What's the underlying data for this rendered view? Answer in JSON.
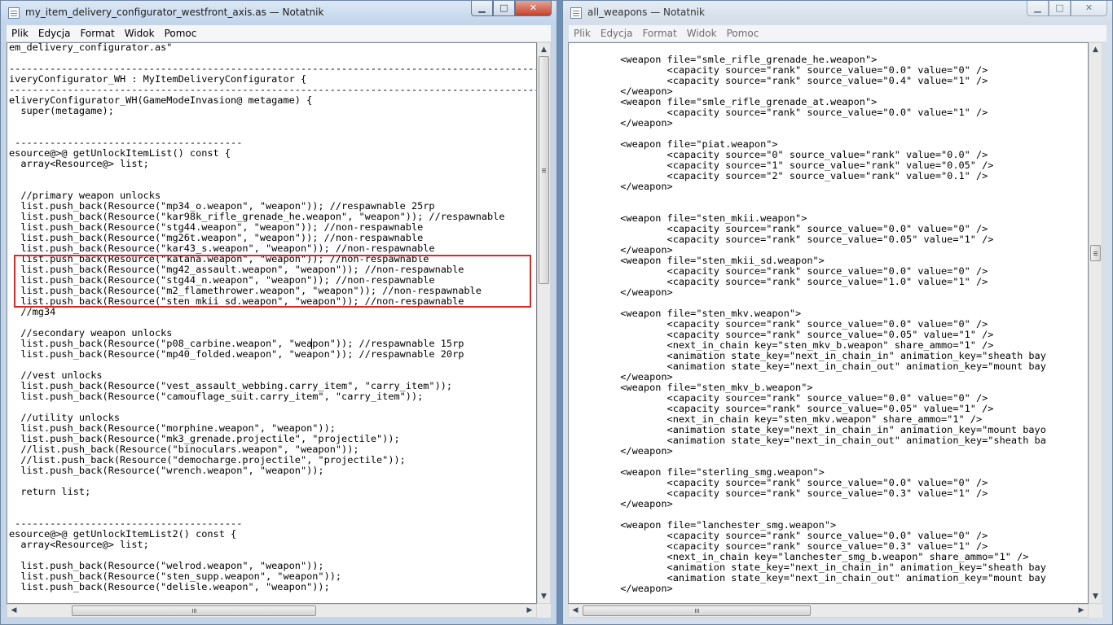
{
  "left_window": {
    "title": "my_item_delivery_configurator_westfront_axis.as — Notatnik",
    "menu": [
      "Plik",
      "Edycja",
      "Format",
      "Widok",
      "Pomoc"
    ],
    "code_lines": [
      "em_delivery_configurator.as\"",
      "",
      "--------------------------------------------------------------------------------------------------",
      "iveryConfigurator_WH : MyItemDeliveryConfigurator {",
      "--------------------------------------------------------------------------------------------------",
      "eliveryConfigurator_WH(GameModeInvasion@ metagame) {",
      "  super(metagame);",
      "",
      "",
      " ---------------------------------------",
      "esource@>@ getUnlockItemList() const {",
      "  array<Resource@> list;",
      "",
      "",
      "  //primary weapon unlocks",
      "  list.push_back(Resource(\"mp34_o.weapon\", \"weapon\")); //respawnable 25rp",
      "  list.push_back(Resource(\"kar98k_rifle_grenade_he.weapon\", \"weapon\")); //respawnable",
      "  list.push_back(Resource(\"stg44.weapon\", \"weapon\")); //non-respawnable",
      "  list.push_back(Resource(\"mg26t.weapon\", \"weapon\")); //non-respawnable",
      "  list.push_back(Resource(\"kar43_s.weapon\", \"weapon\")); //non-respawnable",
      "  list.push_back(Resource(\"katana.weapon\", \"weapon\")); //non-respawnable",
      "  list.push_back(Resource(\"mg42_assault.weapon\", \"weapon\")); //non-respawnable",
      "  list.push_back(Resource(\"stg44_n.weapon\", \"weapon\")); //non-respawnable",
      "  list.push_back(Resource(\"m2_flamethrower.weapon\", \"weapon\")); //non-respawnable",
      "  list.push_back(Resource(\"sten_mkii_sd.weapon\", \"weapon\")); //non-respawnable",
      "  //mg34",
      "",
      "  //secondary weapon unlocks",
      "  list.push_back(Resource(\"p08_carbine.weapon\", \"weapon\")); //respawnable 15rp",
      "  list.push_back(Resource(\"mp40_folded.weapon\", \"weapon\")); //respawnable 20rp",
      "",
      "  //vest unlocks",
      "  list.push_back(Resource(\"vest_assault_webbing.carry_item\", \"carry_item\"));",
      "  list.push_back(Resource(\"camouflage_suit.carry_item\", \"carry_item\"));",
      "",
      "  //utility unlocks",
      "  list.push_back(Resource(\"morphine.weapon\", \"weapon\"));",
      "  list.push_back(Resource(\"mk3_grenade.projectile\", \"projectile\"));",
      "  //list.push_back(Resource(\"binoculars.weapon\", \"weapon\"));",
      "  //list.push_back(Resource(\"democharge.projectile\", \"projectile\"));",
      "  list.push_back(Resource(\"wrench.weapon\", \"weapon\"));",
      "",
      "  return list;",
      "",
      "",
      " ---------------------------------------",
      "esource@>@ getUnlockItemList2() const {",
      "  array<Resource@> list;",
      "",
      "  list.push_back(Resource(\"welrod.weapon\", \"weapon\"));",
      "  list.push_back(Resource(\"sten_supp.weapon\", \"weapon\"));",
      "  list.push_back(Resource(\"delisle.weapon\", \"weapon\"));"
    ]
  },
  "right_window": {
    "title": "all_weapons — Notatnik",
    "menu": [
      "Plik",
      "Edycja",
      "Format",
      "Widok",
      "Pomoc"
    ],
    "code_lines": [
      "        <weapon file=\"smle_rifle_grenade_he.weapon\">",
      "                <capacity source=\"rank\" source_value=\"0.0\" value=\"0\" />",
      "                <capacity source=\"rank\" source_value=\"0.4\" value=\"1\" />",
      "        </weapon>",
      "        <weapon file=\"smle_rifle_grenade_at.weapon\">",
      "                <capacity source=\"rank\" source_value=\"0.0\" value=\"1\" />",
      "        </weapon>",
      "",
      "        <weapon file=\"piat.weapon\">",
      "                <capacity source=\"0\" source_value=\"rank\" value=\"0.0\" />",
      "                <capacity source=\"1\" source_value=\"rank\" value=\"0.05\" />",
      "                <capacity source=\"2\" source_value=\"rank\" value=\"0.1\" />",
      "        </weapon>",
      "",
      "",
      "        <weapon file=\"sten_mkii.weapon\">",
      "                <capacity source=\"rank\" source_value=\"0.0\" value=\"0\" />",
      "                <capacity source=\"rank\" source_value=\"0.05\" value=\"1\" />",
      "        </weapon>",
      "        <weapon file=\"sten_mkii_sd.weapon\">",
      "                <capacity source=\"rank\" source_value=\"0.0\" value=\"0\" />",
      "                <capacity source=\"rank\" source_value=\"1.0\" value=\"1\" />",
      "        </weapon>",
      "",
      "        <weapon file=\"sten_mkv.weapon\">",
      "                <capacity source=\"rank\" source_value=\"0.0\" value=\"0\" />",
      "                <capacity source=\"rank\" source_value=\"0.05\" value=\"1\" />",
      "                <next_in_chain key=\"sten_mkv_b.weapon\" share_ammo=\"1\" />",
      "                <animation state_key=\"next_in_chain_in\" animation_key=\"sheath bay",
      "                <animation state_key=\"next_in_chain_out\" animation_key=\"mount bay",
      "        </weapon>",
      "        <weapon file=\"sten_mkv_b.weapon\">",
      "                <capacity source=\"rank\" source_value=\"0.0\" value=\"0\" />",
      "                <capacity source=\"rank\" source_value=\"0.05\" value=\"1\" />",
      "                <next_in_chain key=\"sten_mkv.weapon\" share_ammo=\"1\" />",
      "                <animation state_key=\"next_in_chain_in\" animation_key=\"mount bayo",
      "                <animation state_key=\"next_in_chain_out\" animation_key=\"sheath ba",
      "        </weapon>",
      "",
      "        <weapon file=\"sterling_smg.weapon\">",
      "                <capacity source=\"rank\" source_value=\"0.0\" value=\"0\" />",
      "                <capacity source=\"rank\" source_value=\"0.3\" value=\"1\" />",
      "        </weapon>",
      "",
      "        <weapon file=\"lanchester_smg.weapon\">",
      "                <capacity source=\"rank\" source_value=\"0.0\" value=\"0\" />",
      "                <capacity source=\"rank\" source_value=\"0.3\" value=\"1\" />",
      "                <next_in_chain key=\"lanchester_smg_b.weapon\" share_ammo=\"1\" />",
      "                <animation state_key=\"next_in_chain_in\" animation_key=\"sheath bay",
      "                <animation state_key=\"next_in_chain_out\" animation_key=\"mount bay",
      "        </weapon>"
    ]
  },
  "colors": {
    "highlight_box": "#d92a2a",
    "close_button": "#c4412a"
  }
}
